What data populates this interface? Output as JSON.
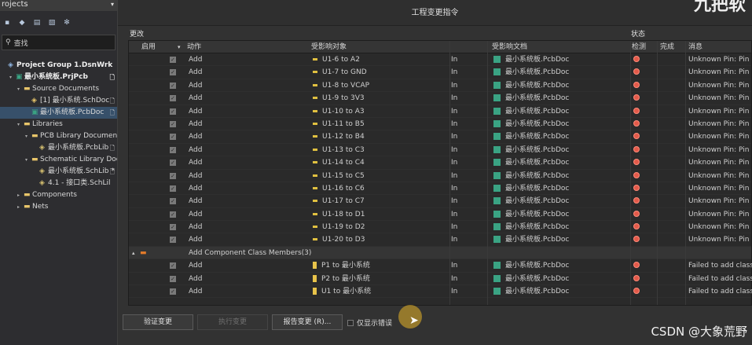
{
  "projects_panel": {
    "title": "rojects",
    "search_placeholder": "查找",
    "tree": [
      {
        "label": "Project Group 1.DsnWrk",
        "indent": 0,
        "bold": true,
        "icon": "workspace-icon",
        "twisty": "",
        "doc": ""
      },
      {
        "label": "最小系统板.PrjPcb",
        "indent": 1,
        "bold": true,
        "icon": "pcb-project-icon",
        "twisty": "▾",
        "doc": "🗋"
      },
      {
        "label": "Source Documents",
        "indent": 2,
        "icon": "folder-icon",
        "twisty": "▾",
        "doc": ""
      },
      {
        "label": "[1] 最小系统.SchDoc",
        "indent": 3,
        "icon": "schdoc-icon",
        "twisty": "",
        "doc": "🗋"
      },
      {
        "label": "最小系统板.PcbDoc",
        "indent": 3,
        "icon": "pcbdoc-icon",
        "twisty": "",
        "doc": "🗋",
        "selected": true
      },
      {
        "label": "Libraries",
        "indent": 2,
        "icon": "folder-icon",
        "twisty": "▾",
        "doc": ""
      },
      {
        "label": "PCB Library Documen",
        "indent": 3,
        "icon": "folder-icon",
        "twisty": "▾",
        "doc": ""
      },
      {
        "label": "最小系统板.PcbLib",
        "indent": 4,
        "icon": "pcblib-icon",
        "twisty": "",
        "doc": "🗋"
      },
      {
        "label": "Schematic Library Doc",
        "indent": 3,
        "icon": "folder-icon",
        "twisty": "▾",
        "doc": ""
      },
      {
        "label": "最小系统板.SchLib *",
        "indent": 4,
        "icon": "schlib-icon",
        "twisty": "",
        "doc": "🗋"
      },
      {
        "label": "4.1  - 接口类.SchLil",
        "indent": 4,
        "icon": "schlib-icon",
        "twisty": "",
        "doc": ""
      },
      {
        "label": "Components",
        "indent": 2,
        "icon": "folder-icon",
        "twisty": "▸",
        "doc": ""
      },
      {
        "label": "Nets",
        "indent": 2,
        "icon": "folder-icon",
        "twisty": "▸",
        "doc": ""
      }
    ]
  },
  "dialog": {
    "title": "工程变更指令",
    "section_changes": "更改",
    "section_status": "状态",
    "columns": {
      "enable": "启用",
      "action": "动作",
      "affected_object": "受影响对象",
      "affected_document": "受影响文档",
      "check": "检测",
      "done": "完成",
      "message": "消息"
    },
    "rows": [
      {
        "type": "item",
        "action": "Add",
        "object": "U1-6 to A2",
        "in": "In",
        "document": "最小系统板.PcbDoc",
        "message": "Unknown Pin: Pin U"
      },
      {
        "type": "item",
        "action": "Add",
        "object": "U1-7 to GND",
        "in": "In",
        "document": "最小系统板.PcbDoc",
        "message": "Unknown Pin: Pin U"
      },
      {
        "type": "item",
        "action": "Add",
        "object": "U1-8 to VCAP",
        "in": "In",
        "document": "最小系统板.PcbDoc",
        "message": "Unknown Pin: Pin U"
      },
      {
        "type": "item",
        "action": "Add",
        "object": "U1-9 to 3V3",
        "in": "In",
        "document": "最小系统板.PcbDoc",
        "message": "Unknown Pin: Pin U"
      },
      {
        "type": "item",
        "action": "Add",
        "object": "U1-10 to A3",
        "in": "In",
        "document": "最小系统板.PcbDoc",
        "message": "Unknown Pin: Pin U"
      },
      {
        "type": "item",
        "action": "Add",
        "object": "U1-11 to B5",
        "in": "In",
        "document": "最小系统板.PcbDoc",
        "message": "Unknown Pin: Pin U"
      },
      {
        "type": "item",
        "action": "Add",
        "object": "U1-12 to B4",
        "in": "In",
        "document": "最小系统板.PcbDoc",
        "message": "Unknown Pin: Pin U"
      },
      {
        "type": "item",
        "action": "Add",
        "object": "U1-13 to C3",
        "in": "In",
        "document": "最小系统板.PcbDoc",
        "message": "Unknown Pin: Pin U"
      },
      {
        "type": "item",
        "action": "Add",
        "object": "U1-14 to C4",
        "in": "In",
        "document": "最小系统板.PcbDoc",
        "message": "Unknown Pin: Pin U"
      },
      {
        "type": "item",
        "action": "Add",
        "object": "U1-15 to C5",
        "in": "In",
        "document": "最小系统板.PcbDoc",
        "message": "Unknown Pin: Pin U"
      },
      {
        "type": "item",
        "action": "Add",
        "object": "U1-16 to C6",
        "in": "In",
        "document": "最小系统板.PcbDoc",
        "message": "Unknown Pin: Pin U"
      },
      {
        "type": "item",
        "action": "Add",
        "object": "U1-17 to C7",
        "in": "In",
        "document": "最小系统板.PcbDoc",
        "message": "Unknown Pin: Pin U"
      },
      {
        "type": "item",
        "action": "Add",
        "object": "U1-18 to D1",
        "in": "In",
        "document": "最小系统板.PcbDoc",
        "message": "Unknown Pin: Pin U"
      },
      {
        "type": "item",
        "action": "Add",
        "object": "U1-19 to D2",
        "in": "In",
        "document": "最小系统板.PcbDoc",
        "message": "Unknown Pin: Pin U"
      },
      {
        "type": "item",
        "action": "Add",
        "object": "U1-20 to D3",
        "in": "In",
        "document": "最小系统板.PcbDoc",
        "message": "Unknown Pin: Pin U"
      },
      {
        "type": "group",
        "label": "Add Component Class Members(3)",
        "count": 3
      },
      {
        "type": "class",
        "action": "Add",
        "object": "P1 to 最小系统",
        "in": "In",
        "document": "最小系统板.PcbDoc",
        "message": "Failed to add class n"
      },
      {
        "type": "class",
        "action": "Add",
        "object": "P2 to 最小系统",
        "in": "In",
        "document": "最小系统板.PcbDoc",
        "message": "Failed to add class n"
      },
      {
        "type": "class",
        "action": "Add",
        "object": "U1 to 最小系统",
        "in": "In",
        "document": "最小系统板.PcbDoc",
        "message": "Failed to add class n"
      }
    ],
    "buttons": {
      "validate": "验证变更",
      "execute": "执行变更",
      "report": "报告变更 (R)...",
      "only_errors": "仅显示错误"
    }
  },
  "watermark": "CSDN @大象荒野",
  "watermark_top": "九把软",
  "colors": {
    "error": "#e35a4a",
    "selected": "#37506a",
    "pcb_icon": "#3aa383",
    "component_icon": "#e0c040"
  }
}
